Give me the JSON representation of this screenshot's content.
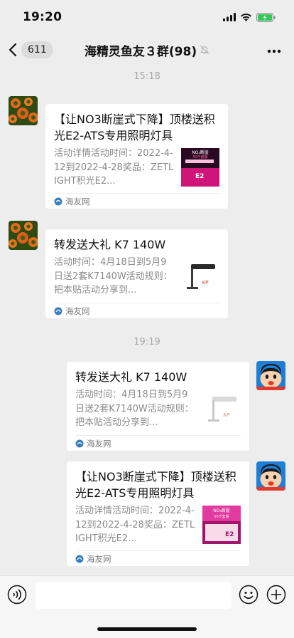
{
  "status": {
    "time": "19:20"
  },
  "nav": {
    "back_count": "611",
    "title": "海精灵鱼友３群(98)"
  },
  "times": [
    "15:18",
    "19:19"
  ],
  "messages": [
    {
      "side": "left",
      "title": "【让NO3断崖式下降】顶楼送积光E2-ATS专用照明灯具",
      "desc": "活动详情活动时间：2022-4-12到2022-4-28奖品：ZETLIGHT积光E2...",
      "thumb_text": [
        "NO₃断崖",
        "50千套餐",
        "E2"
      ],
      "source": "海友网"
    },
    {
      "side": "left",
      "title": "转发送大礼 K7 140W",
      "desc": "活动时间：4月18日到5月9日送2套K7140W活动规则：把本贴活动分享到...",
      "thumb_text": [
        "KP"
      ],
      "source": "海友网"
    },
    {
      "side": "right",
      "title": "转发送大礼 K7 140W",
      "desc": "活动时间：4月18日到5月9日送2套K7140W活动规则：把本贴活动分享到...",
      "thumb_text": [
        "KP"
      ],
      "source": "海友网"
    },
    {
      "side": "right",
      "title": "【让NO3断崖式下降】顶楼送积光E2-ATS专用照明灯具",
      "desc": "活动详情活动时间：2022-4-12到2022-4-28奖品：ZETLIGHT积光E2...",
      "thumb_text": [
        "NO₃断崖",
        "50千套餐",
        "E2"
      ],
      "source": "海友网"
    }
  ],
  "input": {
    "value": ""
  },
  "colors": {
    "background": "#ededed",
    "card": "#ffffff",
    "source_icon": "#3a7dbd",
    "thumb_magenta": "#d0157a"
  },
  "icons": [
    "chevron-left-icon",
    "mute-bell-icon",
    "more-icon",
    "voice-icon",
    "emoji-icon",
    "plus-icon",
    "signal-icon",
    "wifi-icon",
    "battery-icon"
  ]
}
